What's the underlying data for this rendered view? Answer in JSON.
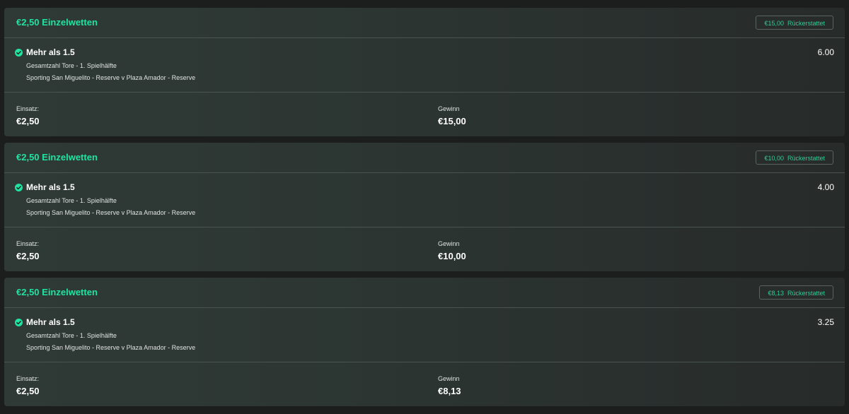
{
  "bets": [
    {
      "title": "€2,50 Einzelwetten",
      "refund_amount": "€15,00",
      "refund_label": "Rückerstattet",
      "selection": "Mehr als 1.5",
      "market": "Gesamtzahl Tore - 1. Spielhälfte",
      "event": "Sporting San Miguelito - Reserve v Plaza Amador - Reserve",
      "odds": "6.00",
      "stake_label": "Einsatz:",
      "stake": "€2,50",
      "payout_label": "Gewinn",
      "payout": "€15,00"
    },
    {
      "title": "€2,50 Einzelwetten",
      "refund_amount": "€10,00",
      "refund_label": "Rückerstattet",
      "selection": "Mehr als 1.5",
      "market": "Gesamtzahl Tore - 1. Spielhälfte",
      "event": "Sporting San Miguelito - Reserve v Plaza Amador - Reserve",
      "odds": "4.00",
      "stake_label": "Einsatz:",
      "stake": "€2,50",
      "payout_label": "Gewinn",
      "payout": "€10,00"
    },
    {
      "title": "€2,50 Einzelwetten",
      "refund_amount": "€8,13",
      "refund_label": "Rückerstattet",
      "selection": "Mehr als 1.5",
      "market": "Gesamtzahl Tore - 1. Spielhälfte",
      "event": "Sporting San Miguelito - Reserve v Plaza Amador - Reserve",
      "odds": "3.25",
      "stake_label": "Einsatz:",
      "stake": "€2,50",
      "payout_label": "Gewinn",
      "payout": "€8,13"
    }
  ],
  "icons": {
    "selection_status": "check-circle-icon"
  },
  "colors": {
    "accent": "#20e3a0",
    "badge_text": "#35c99a",
    "card_bg": "#2c3532",
    "page_bg": "#1c1d1d"
  }
}
